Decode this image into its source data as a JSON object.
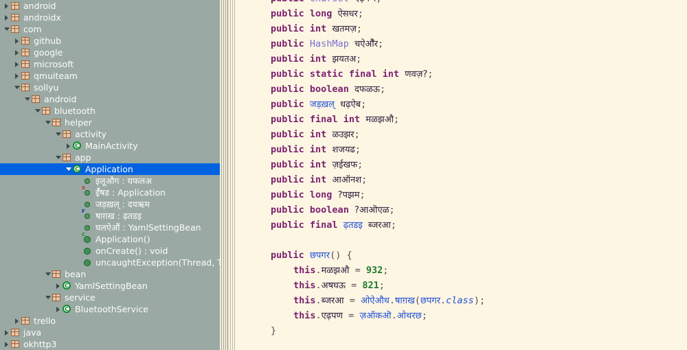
{
  "explorer": {
    "name": "package-explorer",
    "background": "#9aa9a4",
    "selection_color": "#0062e0",
    "rows": [
      {
        "label": "android",
        "depth": 0,
        "twisty": "closed",
        "icon": "package-icon",
        "selected": false
      },
      {
        "label": "androidx",
        "depth": 0,
        "twisty": "closed",
        "icon": "package-icon",
        "selected": false
      },
      {
        "label": "com",
        "depth": 0,
        "twisty": "open",
        "icon": "package-icon",
        "selected": false
      },
      {
        "label": "github",
        "depth": 1,
        "twisty": "closed",
        "icon": "package-icon",
        "selected": false
      },
      {
        "label": "google",
        "depth": 1,
        "twisty": "closed",
        "icon": "package-icon",
        "selected": false
      },
      {
        "label": "microsoft",
        "depth": 1,
        "twisty": "closed",
        "icon": "package-icon",
        "selected": false
      },
      {
        "label": "qmuiteam",
        "depth": 1,
        "twisty": "closed",
        "icon": "package-icon",
        "selected": false
      },
      {
        "label": "sollyu",
        "depth": 1,
        "twisty": "open",
        "icon": "package-icon",
        "selected": false
      },
      {
        "label": "android",
        "depth": 2,
        "twisty": "open",
        "icon": "package-icon",
        "selected": false
      },
      {
        "label": "bluetooth",
        "depth": 3,
        "twisty": "open",
        "icon": "package-icon",
        "selected": false
      },
      {
        "label": "helper",
        "depth": 4,
        "twisty": "open",
        "icon": "package-icon",
        "selected": false
      },
      {
        "label": "activity",
        "depth": 5,
        "twisty": "open",
        "icon": "package-icon",
        "selected": false
      },
      {
        "label": "MainActivity",
        "depth": 6,
        "twisty": "closed",
        "icon": "class-icon",
        "selected": false
      },
      {
        "label": "app",
        "depth": 5,
        "twisty": "open",
        "icon": "package-icon",
        "selected": false
      },
      {
        "label": "Application",
        "depth": 6,
        "twisty": "open",
        "icon": "class-icon",
        "selected": true
      },
      {
        "label": "इलूऔग : घफलअ",
        "depth": 7,
        "twisty": "none",
        "icon": "field-icon",
        "selected": false
      },
      {
        "label": "ईऀषड : Application",
        "depth": 7,
        "twisty": "none",
        "icon": "field-icon",
        "badge": "S",
        "selected": false
      },
      {
        "label": "जड़ख़ल् : दयऋम",
        "depth": 7,
        "twisty": "none",
        "icon": "field-icon",
        "selected": false
      },
      {
        "label": "षाग़ख : ढ़तडइ",
        "depth": 7,
        "twisty": "none",
        "icon": "field-icon",
        "badge": "F",
        "selected": false
      },
      {
        "label": "घलऐऔं : YamlSettingBean",
        "depth": 7,
        "twisty": "none",
        "icon": "field-icon",
        "selected": false
      },
      {
        "label": "Application()",
        "depth": 7,
        "twisty": "none",
        "icon": "method-icon",
        "badge": "C",
        "selected": false
      },
      {
        "label": "onCreate() : void",
        "depth": 7,
        "twisty": "none",
        "icon": "method-icon",
        "selected": false
      },
      {
        "label": "uncaughtException(Thread, Thro",
        "depth": 7,
        "twisty": "none",
        "icon": "method-icon",
        "selected": false
      },
      {
        "label": "bean",
        "depth": 4,
        "twisty": "open",
        "icon": "package-icon",
        "selected": false
      },
      {
        "label": "YamlSettingBean",
        "depth": 5,
        "twisty": "closed",
        "icon": "class-icon",
        "selected": false
      },
      {
        "label": "service",
        "depth": 4,
        "twisty": "open",
        "icon": "package-icon",
        "selected": false
      },
      {
        "label": "BluetoothService",
        "depth": 5,
        "twisty": "closed",
        "icon": "class-icon",
        "selected": false
      },
      {
        "label": "trello",
        "depth": 1,
        "twisty": "closed",
        "icon": "package-icon",
        "selected": false
      },
      {
        "label": "java",
        "depth": 0,
        "twisty": "closed",
        "icon": "package-icon",
        "selected": false
      },
      {
        "label": "okhttp3",
        "depth": 0,
        "twisty": "closed",
        "icon": "package-icon",
        "selected": false
      }
    ]
  },
  "editor": {
    "name": "java-source-editor",
    "background": "#fdf6e3",
    "keyword_color": "#7a1f6e",
    "type_color": "#7b6fd4",
    "number_color": "#1f7a2e",
    "lines": [
      {
        "indent": 0,
        "tokens": [
          {
            "t": "public",
            "c": "kw"
          },
          {
            "t": " ",
            "c": "pun"
          },
          {
            "t": "Charset",
            "c": "ty"
          },
          {
            "t": " ",
            "c": "pun"
          },
          {
            "t": "एढ़पण",
            "c": "dev"
          },
          {
            "t": ";",
            "c": "pun"
          }
        ]
      },
      {
        "indent": 0,
        "tokens": [
          {
            "t": "public",
            "c": "kw"
          },
          {
            "t": " ",
            "c": "pun"
          },
          {
            "t": "long",
            "c": "kw"
          },
          {
            "t": " ",
            "c": "pun"
          },
          {
            "t": "ऐसधर",
            "c": "dev"
          },
          {
            "t": ";",
            "c": "pun"
          }
        ]
      },
      {
        "indent": 0,
        "tokens": [
          {
            "t": "public",
            "c": "kw"
          },
          {
            "t": " ",
            "c": "pun"
          },
          {
            "t": "int",
            "c": "kw"
          },
          {
            "t": " ",
            "c": "pun"
          },
          {
            "t": "खतमज़",
            "c": "dev"
          },
          {
            "t": ";",
            "c": "pun"
          }
        ]
      },
      {
        "indent": 0,
        "tokens": [
          {
            "t": "public",
            "c": "kw"
          },
          {
            "t": " ",
            "c": "pun"
          },
          {
            "t": "HashMap",
            "c": "ty"
          },
          {
            "t": " ",
            "c": "pun"
          },
          {
            "t": "चऐऔेर",
            "c": "dev"
          },
          {
            "t": ";",
            "c": "pun"
          }
        ]
      },
      {
        "indent": 0,
        "tokens": [
          {
            "t": "public",
            "c": "kw"
          },
          {
            "t": " ",
            "c": "pun"
          },
          {
            "t": "int",
            "c": "kw"
          },
          {
            "t": " ",
            "c": "pun"
          },
          {
            "t": "झयतअ‌",
            "c": "dev"
          },
          {
            "t": ";",
            "c": "pun"
          }
        ]
      },
      {
        "indent": 0,
        "tokens": [
          {
            "t": "public",
            "c": "kw"
          },
          {
            "t": " ",
            "c": "pun"
          },
          {
            "t": "static",
            "c": "kw"
          },
          {
            "t": " ",
            "c": "pun"
          },
          {
            "t": "final",
            "c": "kw"
          },
          {
            "t": " ",
            "c": "pun"
          },
          {
            "t": "int",
            "c": "kw"
          },
          {
            "t": " ",
            "c": "pun"
          },
          {
            "t": "णवज़?",
            "c": "dev"
          },
          {
            "t": ";",
            "c": "pun"
          }
        ]
      },
      {
        "indent": 0,
        "tokens": [
          {
            "t": "public",
            "c": "kw"
          },
          {
            "t": " ",
            "c": "pun"
          },
          {
            "t": "boolean",
            "c": "kw"
          },
          {
            "t": " ",
            "c": "pun"
          },
          {
            "t": "दफळऊ",
            "c": "dev"
          },
          {
            "t": ";",
            "c": "pun"
          }
        ]
      },
      {
        "indent": 0,
        "tokens": [
          {
            "t": "public",
            "c": "kw"
          },
          {
            "t": " ",
            "c": "pun"
          },
          {
            "t": "जड़ख़ल्",
            "c": "devb"
          },
          {
            "t": " ",
            "c": "pun"
          },
          {
            "t": "धढ़ऐब",
            "c": "dev"
          },
          {
            "t": ";",
            "c": "pun"
          }
        ]
      },
      {
        "indent": 0,
        "tokens": [
          {
            "t": "public",
            "c": "kw"
          },
          {
            "t": " ",
            "c": "pun"
          },
          {
            "t": "final",
            "c": "kw"
          },
          {
            "t": " ",
            "c": "pun"
          },
          {
            "t": "int",
            "c": "kw"
          },
          {
            "t": " ",
            "c": "pun"
          },
          {
            "t": "मळझऔ",
            "c": "dev"
          },
          {
            "t": ";",
            "c": "pun"
          }
        ]
      },
      {
        "indent": 0,
        "tokens": [
          {
            "t": "public",
            "c": "kw"
          },
          {
            "t": " ",
            "c": "pun"
          },
          {
            "t": "int",
            "c": "kw"
          },
          {
            "t": " ",
            "c": "pun"
          },
          {
            "t": "ळउझर",
            "c": "dev"
          },
          {
            "t": ";",
            "c": "pun"
          }
        ]
      },
      {
        "indent": 0,
        "tokens": [
          {
            "t": "public",
            "c": "kw"
          },
          {
            "t": " ",
            "c": "pun"
          },
          {
            "t": "int",
            "c": "kw"
          },
          {
            "t": " ",
            "c": "pun"
          },
          {
            "t": "शजयढ",
            "c": "dev"
          },
          {
            "t": ";",
            "c": "pun"
          }
        ]
      },
      {
        "indent": 0,
        "tokens": [
          {
            "t": "public",
            "c": "kw"
          },
          {
            "t": " ",
            "c": "pun"
          },
          {
            "t": "int",
            "c": "kw"
          },
          {
            "t": " ",
            "c": "pun"
          },
          {
            "t": "ज़ईखफ",
            "c": "dev"
          },
          {
            "t": ";",
            "c": "pun"
          }
        ]
      },
      {
        "indent": 0,
        "tokens": [
          {
            "t": "public",
            "c": "kw"
          },
          {
            "t": " ",
            "c": "pun"
          },
          {
            "t": "int",
            "c": "kw"
          },
          {
            "t": " ",
            "c": "pun"
          },
          {
            "t": "आऑनश",
            "c": "dev"
          },
          {
            "t": ";",
            "c": "pun"
          }
        ]
      },
      {
        "indent": 0,
        "tokens": [
          {
            "t": "public",
            "c": "kw"
          },
          {
            "t": " ",
            "c": "pun"
          },
          {
            "t": "long",
            "c": "kw"
          },
          {
            "t": " ",
            "c": "pun"
          },
          {
            "t": "?पझम",
            "c": "dev"
          },
          {
            "t": ";",
            "c": "pun"
          }
        ]
      },
      {
        "indent": 0,
        "tokens": [
          {
            "t": "public",
            "c": "kw"
          },
          {
            "t": " ",
            "c": "pun"
          },
          {
            "t": "boolean",
            "c": "kw"
          },
          {
            "t": " ",
            "c": "pun"
          },
          {
            "t": "?आऒएळ",
            "c": "dev"
          },
          {
            "t": ";",
            "c": "pun"
          }
        ]
      },
      {
        "indent": 0,
        "tokens": [
          {
            "t": "public",
            "c": "kw"
          },
          {
            "t": " ",
            "c": "pun"
          },
          {
            "t": "final",
            "c": "kw"
          },
          {
            "t": " ",
            "c": "pun"
          },
          {
            "t": "ढ़तडइ",
            "c": "devb"
          },
          {
            "t": " ",
            "c": "pun"
          },
          {
            "t": "ब्जरआ",
            "c": "dev"
          },
          {
            "t": ";",
            "c": "pun"
          }
        ]
      },
      {
        "indent": 0,
        "tokens": []
      },
      {
        "indent": 0,
        "tokens": [
          {
            "t": "public",
            "c": "kw"
          },
          {
            "t": " ",
            "c": "pun"
          },
          {
            "t": "छपगर",
            "c": "devb"
          },
          {
            "t": "() {",
            "c": "pun"
          }
        ]
      },
      {
        "indent": 1,
        "tokens": [
          {
            "t": "this",
            "c": "kw"
          },
          {
            "t": ".",
            "c": "pun"
          },
          {
            "t": "मळझऔ",
            "c": "dev"
          },
          {
            "t": " = ",
            "c": "pun"
          },
          {
            "t": "932",
            "c": "num"
          },
          {
            "t": ";",
            "c": "pun"
          }
        ]
      },
      {
        "indent": 1,
        "tokens": [
          {
            "t": "this",
            "c": "kw"
          },
          {
            "t": ".",
            "c": "pun"
          },
          {
            "t": "अषघऊ",
            "c": "dev"
          },
          {
            "t": " = ",
            "c": "pun"
          },
          {
            "t": "821",
            "c": "num"
          },
          {
            "t": ";",
            "c": "pun"
          }
        ]
      },
      {
        "indent": 1,
        "tokens": [
          {
            "t": "this",
            "c": "kw"
          },
          {
            "t": ".",
            "c": "pun"
          },
          {
            "t": "ब्जरआ",
            "c": "dev"
          },
          {
            "t": " = ",
            "c": "pun"
          },
          {
            "t": "ओऐऔध",
            "c": "devb"
          },
          {
            "t": ".",
            "c": "pun"
          },
          {
            "t": "षाग़ख",
            "c": "devb"
          },
          {
            "t": "(",
            "c": "pun"
          },
          {
            "t": "छपगर",
            "c": "devb"
          },
          {
            "t": ".",
            "c": "pun"
          },
          {
            "t": "class",
            "c": "cls"
          },
          {
            "t": ");",
            "c": "pun"
          }
        ]
      },
      {
        "indent": 1,
        "tokens": [
          {
            "t": "this",
            "c": "kw"
          },
          {
            "t": ".",
            "c": "pun"
          },
          {
            "t": "एढ़पण",
            "c": "dev"
          },
          {
            "t": " = ",
            "c": "pun"
          },
          {
            "t": "ज़ऑकऒ",
            "c": "devb"
          },
          {
            "t": ".",
            "c": "pun"
          },
          {
            "t": "ओथरछ",
            "c": "devb"
          },
          {
            "t": ";",
            "c": "pun"
          }
        ]
      },
      {
        "indent": 0,
        "tokens": [
          {
            "t": "}",
            "c": "pun"
          }
        ]
      }
    ]
  }
}
